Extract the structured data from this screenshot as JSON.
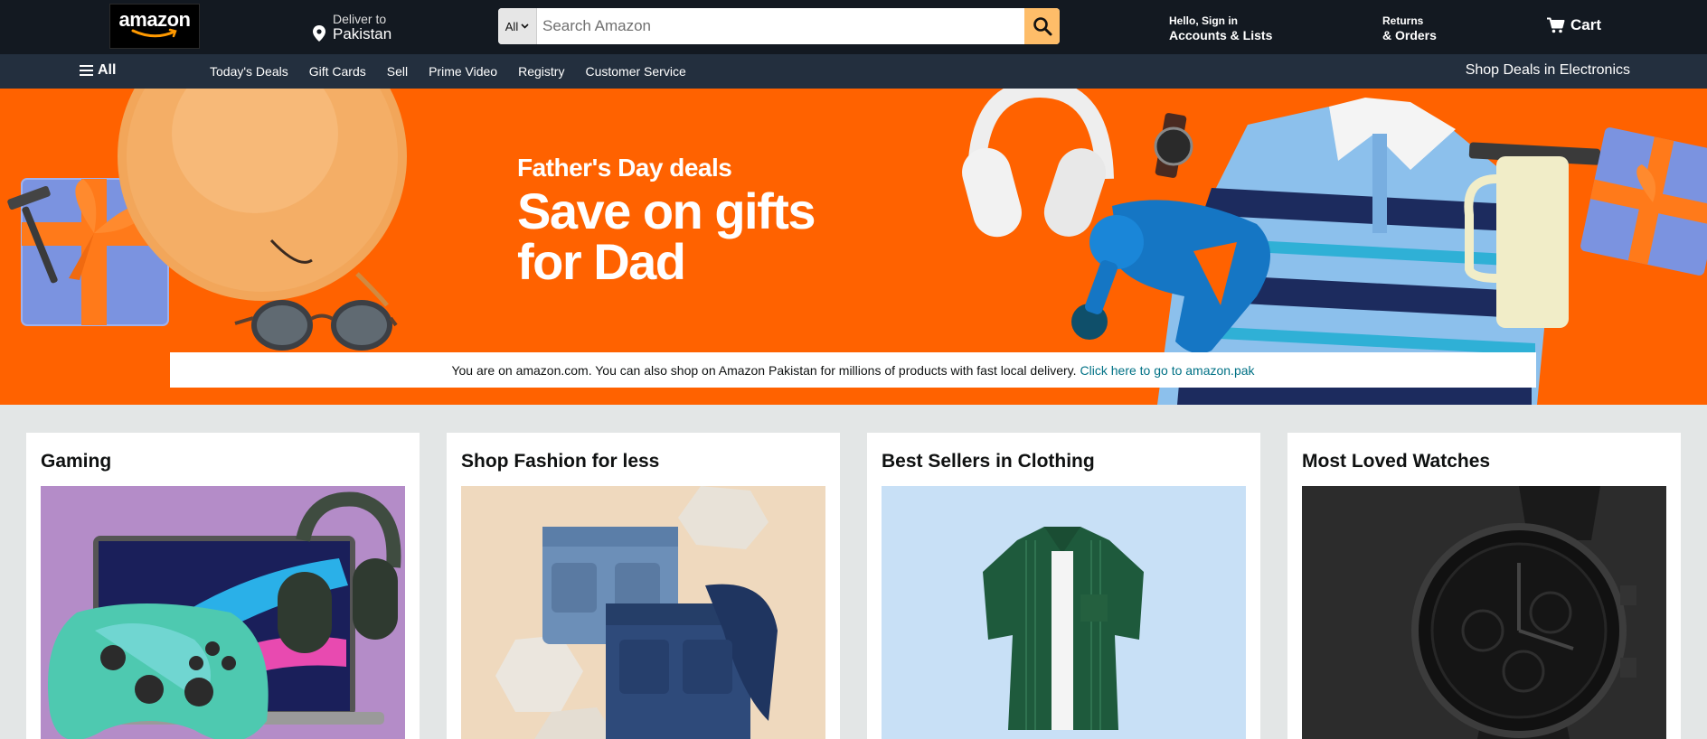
{
  "header": {
    "logo_text": "amazon",
    "deliver_line1": "Deliver to",
    "deliver_line2": "Pakistan",
    "search_category": "All",
    "search_placeholder": "Search Amazon",
    "account_line1": "Hello, Sign in",
    "account_line2": "Accounts & Lists",
    "returns_line1": "Returns",
    "returns_line2": "& Orders",
    "cart_label": "Cart"
  },
  "subnav": {
    "all_label": "All",
    "links": [
      "Today's Deals",
      "Gift Cards",
      "Sell",
      "Prime Video",
      "Registry",
      "Customer Service"
    ],
    "promo": "Shop Deals in Electronics"
  },
  "hero": {
    "subtitle": "Father's Day deals",
    "title": "Save on gifts for Dad",
    "notice_text": "You are on amazon.com. You can also shop on Amazon Pakistan for millions of products with fast local delivery.",
    "notice_link": "Click here to go to amazon.pak"
  },
  "cards": [
    {
      "title": "Gaming"
    },
    {
      "title": "Shop Fashion for less"
    },
    {
      "title": "Best Sellers in Clothing"
    },
    {
      "title": "Most Loved Watches"
    }
  ],
  "colors": {
    "header_bg": "#131921",
    "subnav_bg": "#232f3e",
    "hero_bg": "#ff6200",
    "search_button": "#febd69",
    "link": "#007185"
  }
}
